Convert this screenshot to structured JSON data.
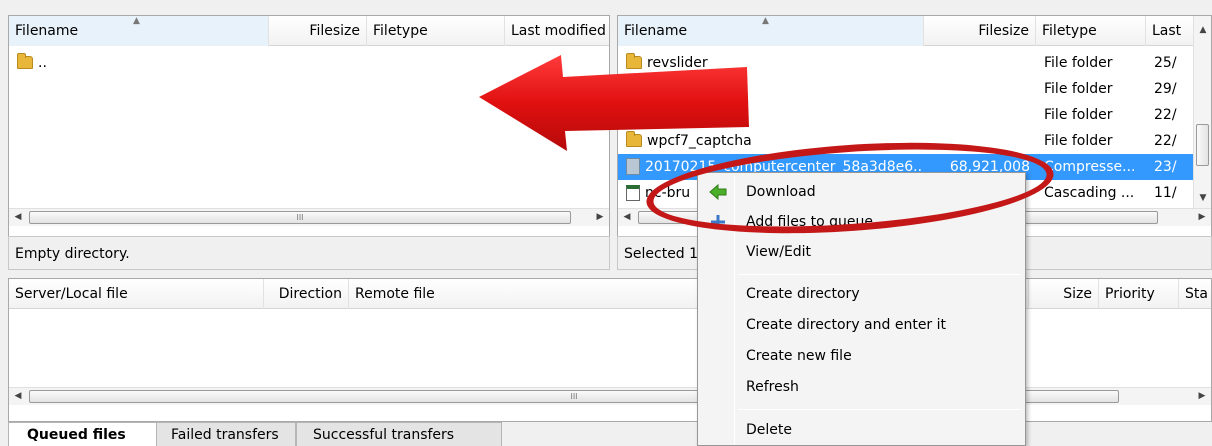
{
  "local": {
    "columns": [
      "Filename",
      "Filesize",
      "Filetype",
      "Last modified"
    ],
    "rows": [
      {
        "name": ".."
      }
    ],
    "status": "Empty directory."
  },
  "remote": {
    "columns": [
      "Filename",
      "Filesize",
      "Filetype",
      "Last"
    ],
    "rows": [
      {
        "name": "revslider",
        "size": "",
        "type": "File folder",
        "modified": "25/"
      },
      {
        "name": "",
        "size": "",
        "type": "File folder",
        "modified": "29/"
      },
      {
        "name": "",
        "size": "",
        "type": "File folder",
        "modified": "22/"
      },
      {
        "name": "wpcf7_captcha",
        "size": "",
        "type": "File folder",
        "modified": "22/"
      },
      {
        "name": "20170215_computercenter_58a3d8e6...",
        "size": "68,921,008",
        "type": "Compresse...",
        "modified": "23/"
      },
      {
        "name": "nc-bru",
        "size": "",
        "type": "Cascading ...",
        "modified": "11/"
      }
    ],
    "status": "Selected 1"
  },
  "queue": {
    "columns": [
      "Server/Local file",
      "Direction",
      "Remote file",
      "Size",
      "Priority",
      "Sta"
    ],
    "tabs": [
      "Queued files",
      "Failed transfers",
      "Successful transfers"
    ]
  },
  "context_menu": {
    "items": [
      "Download",
      "Add files to queue",
      "View/Edit",
      "Create directory",
      "Create directory and enter it",
      "Create new file",
      "Refresh",
      "Delete"
    ]
  },
  "scrollbar": {
    "grip": "III"
  },
  "colors": {
    "selection": "#3399ff",
    "annotation": "#c41818",
    "download_arrow": "#4caf2a"
  }
}
